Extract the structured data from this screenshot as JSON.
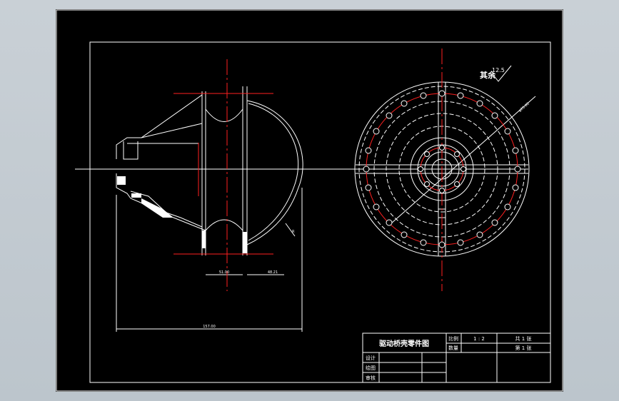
{
  "drawing": {
    "roughness_note": "其余",
    "roughness_value": "12.5",
    "dim_width_1": "51.00",
    "dim_width_2": "48.21",
    "dim_overall": "157.00",
    "dim_radius": "R",
    "dim_diameter": "φ20.00"
  },
  "title_block": {
    "title": "驱动桥壳零件图",
    "scale_label": "比例",
    "scale_value": "1 : 2",
    "sheet_total": "共 1 张",
    "material_label": "数量",
    "sheet_index": "第 1 张",
    "design_label": "设计",
    "draw_label": "绘图",
    "check_label": "审核"
  },
  "colors": {
    "background": "#000000",
    "line": "#ffffff",
    "center_line": "#ff2020",
    "frame_bg": "#c6ced4"
  }
}
